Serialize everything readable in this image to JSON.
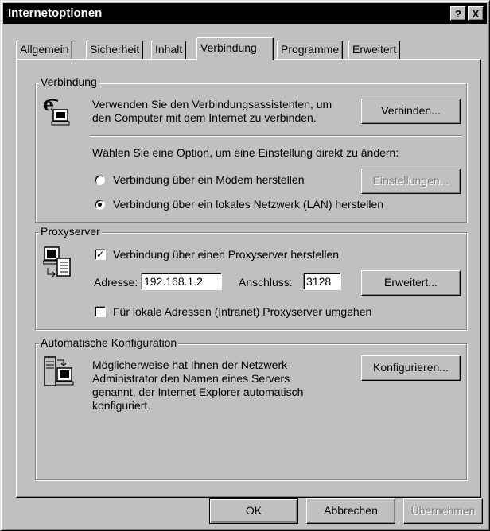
{
  "window": {
    "title": "Internetoptionen"
  },
  "titlebar": {
    "help_label": "?",
    "close_label": "X"
  },
  "tabs": [
    {
      "label": "Allgemein"
    },
    {
      "label": "Sicherheit"
    },
    {
      "label": "Inhalt"
    },
    {
      "label": "Verbindung",
      "active": true
    },
    {
      "label": "Programme"
    },
    {
      "label": "Erweitert"
    }
  ],
  "verbindung": {
    "group_title": "Verbindung",
    "wizard_text_1": "Verwenden Sie den Verbindungsassistenten, um",
    "wizard_text_2": "den Computer mit dem Internet zu verbinden.",
    "connect_button": "Verbinden...",
    "option_prompt": "Wählen Sie eine Option, um eine Einstellung direkt zu ändern:",
    "radio_modem": "Verbindung über ein Modem herstellen",
    "radio_lan": "Verbindung über ein lokales Netzwerk (LAN) herstellen",
    "selected": "lan",
    "settings_button": "Einstellungen..."
  },
  "proxy": {
    "group_title": "Proxyserver",
    "use_proxy_label": "Verbindung über einen Proxyserver herstellen",
    "use_proxy_checked": true,
    "address_label": "Adresse:",
    "address_value": "192.168.1.2",
    "port_label": "Anschluss:",
    "port_value": "3128",
    "advanced_button": "Erweitert...",
    "bypass_label": "Für lokale Adressen (Intranet) Proxyserver umgehen",
    "bypass_checked": false
  },
  "autoconfig": {
    "group_title": "Automatische Konfiguration",
    "text_1": "Möglicherweise hat Ihnen der Netzwerk-",
    "text_2": "Administrator den Namen eines Servers",
    "text_3": "genannt, der Internet Explorer automatisch",
    "text_4": "konfiguriert.",
    "configure_button": "Konfigurieren..."
  },
  "footer": {
    "ok_button": "OK",
    "cancel_button": "Abbrechen",
    "apply_button": "Übernehmen"
  }
}
